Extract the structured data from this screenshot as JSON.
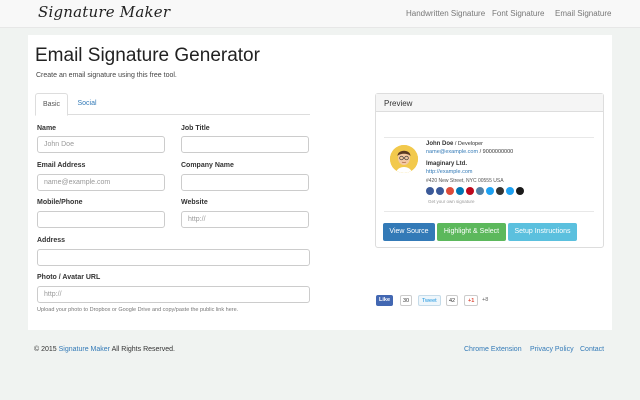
{
  "navbar": {
    "brand": "Signature Maker",
    "links": [
      "Handwritten Signature",
      "Font Signature",
      "Email Signature"
    ]
  },
  "main": {
    "title": "Email Signature Generator",
    "subtitle": "Create an email signature using this free tool.",
    "tabs": [
      "Basic",
      "Social"
    ],
    "active_tab": "Basic",
    "fields": {
      "name": {
        "label": "Name",
        "placeholder": "John Doe",
        "value": ""
      },
      "job_title": {
        "label": "Job Title",
        "placeholder": "",
        "value": ""
      },
      "email": {
        "label": "Email Address",
        "placeholder": "name@example.com",
        "value": ""
      },
      "company": {
        "label": "Company Name",
        "placeholder": "",
        "value": ""
      },
      "mobile": {
        "label": "Mobile/Phone",
        "placeholder": "",
        "value": ""
      },
      "website": {
        "label": "Website",
        "placeholder": "http://",
        "value": ""
      },
      "address": {
        "label": "Address",
        "placeholder": "",
        "value": ""
      },
      "photo": {
        "label": "Photo / Avatar URL",
        "placeholder": "http://",
        "value": ""
      }
    },
    "photo_help": "Upload your photo to Dropbox or Google Drive and copy/paste the public link here."
  },
  "preview": {
    "heading": "Preview",
    "name_line_bold": "John Doe",
    "name_line_rest": " / Developer",
    "email_line_link": "name@example.com",
    "email_line_rest": " / 9000000000",
    "company": "Imaginary Ltd.",
    "website": "http://example.com",
    "address": "#420 New Street, NYC 00555 USA",
    "credit": "Get your own signature",
    "social_colors": [
      "#3b5998",
      "#3b5998",
      "#dd4b39",
      "#0077b5",
      "#bd081c",
      "#517fa4",
      "#1da1f2",
      "#333333",
      "#1da1f2",
      "#1a1a1a"
    ],
    "buttons": [
      {
        "label": "View Source",
        "color": "#337ab7"
      },
      {
        "label": "Highlight & Select",
        "color": "#5cb85c"
      },
      {
        "label": "Setup Instructions",
        "color": "#5bc0de"
      }
    ]
  },
  "share": {
    "like_label": "Like",
    "like_count": "30",
    "tweet_label": "Tweet",
    "tweet_count": "42",
    "gplus_label": "+1",
    "gplus_count": "+8"
  },
  "footer": {
    "copyright_prefix": "© 2015",
    "copyright_link": "Signature Maker",
    "copyright_suffix": "All Rights Reserved.",
    "links": [
      "Chrome Extension",
      "Privacy Policy",
      "Contact"
    ]
  },
  "colors": {
    "link": "#337ab7",
    "page_bg": "#f0f3f1"
  }
}
